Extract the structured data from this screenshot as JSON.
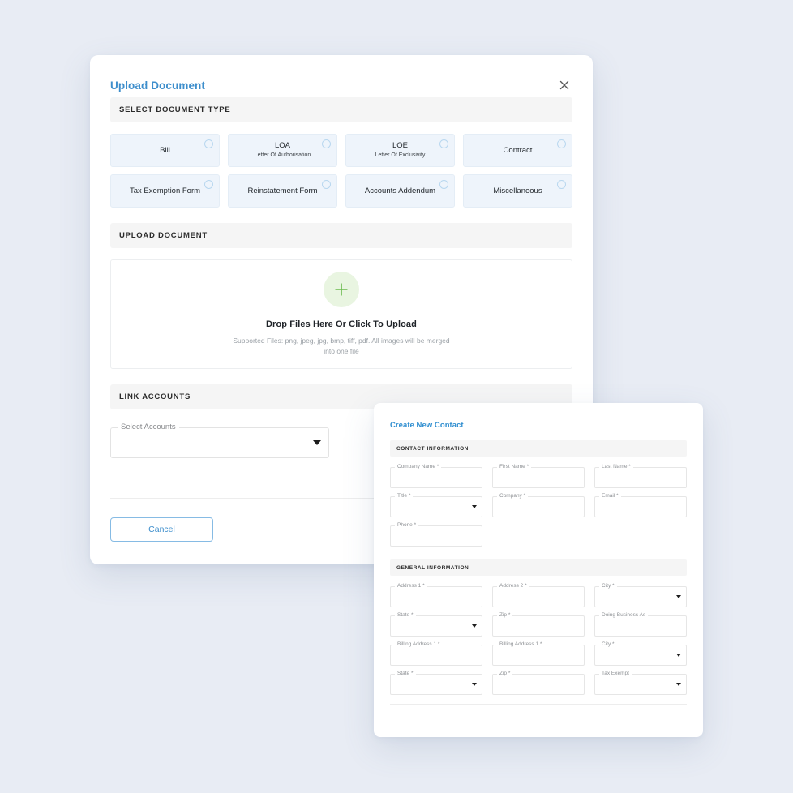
{
  "upload_dialog": {
    "title": "Upload Document",
    "close_icon": "close-icon",
    "sections": {
      "doc_type_header": "SELECT DOCUMENT TYPE",
      "upload_header": "UPLOAD DOCUMENT",
      "link_accounts_header": "LINK ACCOUNTS"
    },
    "document_types": [
      {
        "label": "Bill",
        "sublabel": "",
        "selected": false
      },
      {
        "label": "LOA",
        "sublabel": "Letter Of Authorisation",
        "selected": false
      },
      {
        "label": "LOE",
        "sublabel": "Letter Of Exclusivity",
        "selected": false
      },
      {
        "label": "Contract",
        "sublabel": "",
        "selected": false
      },
      {
        "label": "Tax Exemption Form",
        "sublabel": "",
        "selected": false
      },
      {
        "label": "Reinstatement Form",
        "sublabel": "",
        "selected": false
      },
      {
        "label": "Accounts Addendum",
        "sublabel": "",
        "selected": false
      },
      {
        "label": "Miscellaneous",
        "sublabel": "",
        "selected": false
      }
    ],
    "dropzone": {
      "icon": "plus-icon",
      "title": "Drop Files Here Or Click To Upload",
      "subtitle": "Supported Files: png, jpeg, jpg, bmp, tiff, pdf. All images will be merged into one file"
    },
    "link_accounts": {
      "select_label": "Select Accounts",
      "value": "",
      "caret_icon": "chevron-down-icon"
    },
    "cancel_label": "Cancel",
    "colors": {
      "title_blue": "#3d8ecc",
      "card_bg": "#eef4fb",
      "plus_green": "#6cbb4f",
      "plus_circle_bg": "#e9f5e1"
    }
  },
  "contact_panel": {
    "title": "Create New Contact",
    "contact_information_header": "CONTACT INFORMATION",
    "general_information_header": "GENERAL INFORMATION",
    "contact_fields": [
      {
        "label": "Company Name *",
        "value": "",
        "type": "text"
      },
      {
        "label": "First Name *",
        "value": "",
        "type": "text"
      },
      {
        "label": "Last Name *",
        "value": "",
        "type": "text"
      },
      {
        "label": "Title *",
        "value": "",
        "type": "select"
      },
      {
        "label": "Company *",
        "value": "",
        "type": "text"
      },
      {
        "label": "Email *",
        "value": "",
        "type": "text"
      },
      {
        "label": "Phone *",
        "value": "",
        "type": "text"
      }
    ],
    "general_fields": [
      {
        "label": "Address 1 *",
        "value": "",
        "type": "text"
      },
      {
        "label": "Address 2 *",
        "value": "",
        "type": "text"
      },
      {
        "label": "City *",
        "value": "",
        "type": "select"
      },
      {
        "label": "State *",
        "value": "",
        "type": "select"
      },
      {
        "label": "Zip *",
        "value": "",
        "type": "text"
      },
      {
        "label": "Doing Business As",
        "value": "",
        "type": "text"
      },
      {
        "label": "Billing Address 1 *",
        "value": "",
        "type": "text"
      },
      {
        "label": "Billing Address 1 *",
        "value": "",
        "type": "text"
      },
      {
        "label": "City *",
        "value": "",
        "type": "select"
      },
      {
        "label": "State *",
        "value": "",
        "type": "select"
      },
      {
        "label": "Zip *",
        "value": "",
        "type": "text"
      },
      {
        "label": "Tax Exempt",
        "value": "",
        "type": "select"
      }
    ],
    "colors": {
      "title_blue": "#2f8ed0"
    }
  }
}
